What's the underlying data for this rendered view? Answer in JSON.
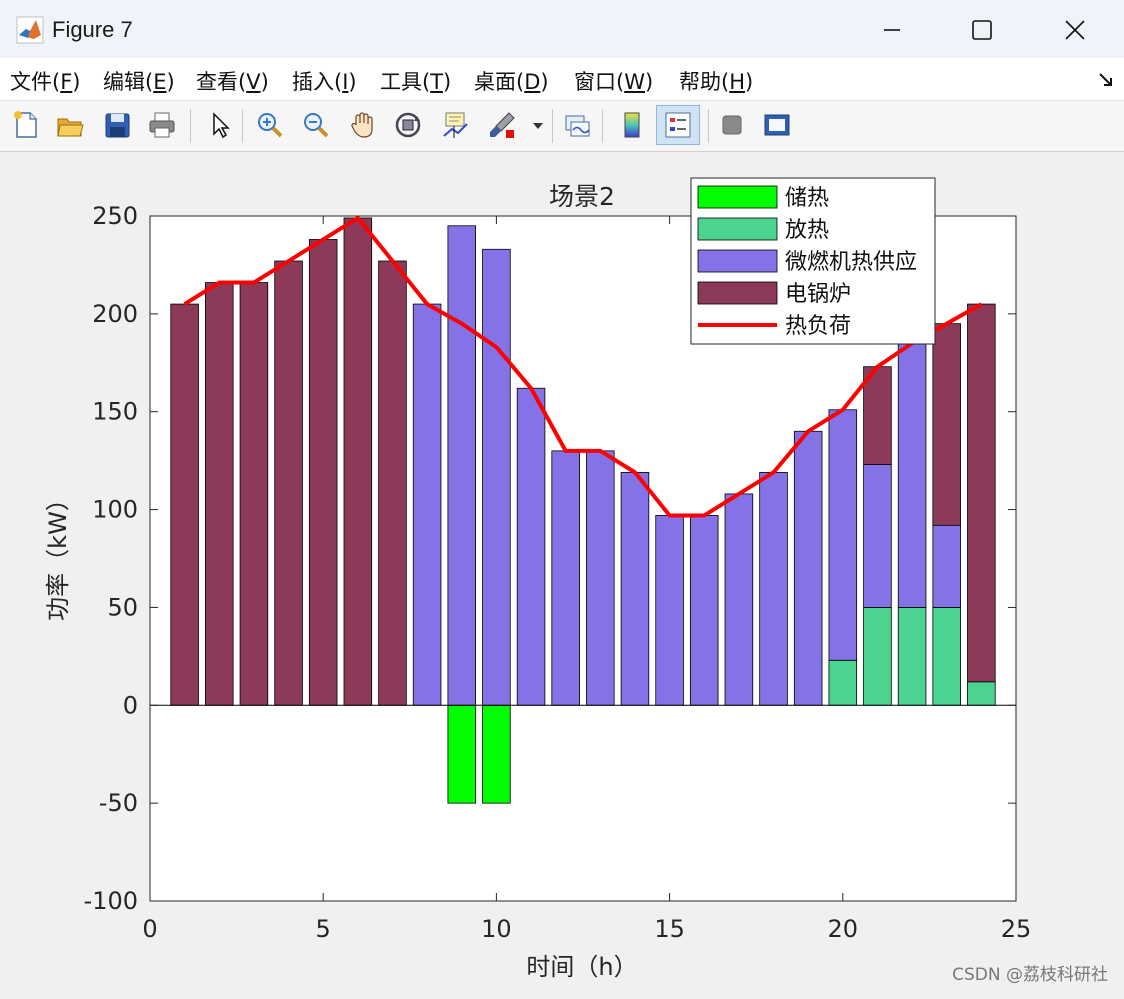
{
  "window": {
    "title": "Figure 7"
  },
  "menu": [
    {
      "text": "文件(",
      "key": "F",
      "end": ")"
    },
    {
      "text": "编辑(",
      "key": "E",
      "end": ")"
    },
    {
      "text": "查看(",
      "key": "V",
      "end": ")"
    },
    {
      "text": "插入(",
      "key": "I",
      "end": ")"
    },
    {
      "text": "工具(",
      "key": "T",
      "end": ")"
    },
    {
      "text": "桌面(",
      "key": "D",
      "end": ")"
    },
    {
      "text": "窗口(",
      "key": "W",
      "end": ")"
    },
    {
      "text": "帮助(",
      "key": "H",
      "end": ")"
    }
  ],
  "toolbar": {
    "tools": [
      "new-figure-icon",
      "open-file-icon",
      "save-icon",
      "print-icon",
      "pointer-icon",
      "zoom-in-icon",
      "zoom-out-icon",
      "pan-hand-icon",
      "rotate-3d-icon",
      "data-cursor-icon",
      "brush-icon",
      "link-plot-icon",
      "colorbar-icon",
      "legend-icon",
      "hide-plot-tools-icon",
      "show-plot-tools-icon"
    ],
    "active": "legend-icon"
  },
  "watermark": "CSDN @荔枝科研社",
  "chart_data": {
    "type": "bar",
    "title": "场景2",
    "xlabel": "时间（h）",
    "ylabel": "功率（kW）",
    "xlim": [
      0,
      25
    ],
    "ylim": [
      -100,
      250
    ],
    "xticks": [
      0,
      5,
      10,
      15,
      20,
      25
    ],
    "yticks": [
      -100,
      -50,
      0,
      50,
      100,
      150,
      200,
      250
    ],
    "grid": false,
    "stacked": true,
    "legend_position": "top-right",
    "x": [
      1,
      2,
      3,
      4,
      5,
      6,
      7,
      8,
      9,
      10,
      11,
      12,
      13,
      14,
      15,
      16,
      17,
      18,
      19,
      20,
      21,
      22,
      23,
      24
    ],
    "series": [
      {
        "name": "储热",
        "kind": "bar",
        "color": "#00ff00",
        "values": [
          0,
          0,
          0,
          0,
          0,
          0,
          0,
          0,
          -50,
          -50,
          0,
          0,
          0,
          0,
          0,
          0,
          0,
          0,
          0,
          0,
          0,
          0,
          0,
          0
        ]
      },
      {
        "name": "放热",
        "kind": "bar",
        "color": "#4dd390",
        "values": [
          0,
          0,
          0,
          0,
          0,
          0,
          0,
          0,
          0,
          0,
          0,
          0,
          0,
          0,
          0,
          0,
          0,
          0,
          0,
          23,
          50,
          50,
          50,
          12
        ]
      },
      {
        "name": "微燃机热供应",
        "kind": "bar",
        "color": "#8473e6",
        "values": [
          0,
          0,
          0,
          0,
          0,
          0,
          0,
          205,
          245,
          233,
          162,
          130,
          130,
          119,
          97,
          97,
          108,
          119,
          140,
          128,
          73,
          143,
          42,
          0
        ]
      },
      {
        "name": "电锅炉",
        "kind": "bar",
        "color": "#8d3a5a",
        "values": [
          205,
          216,
          216,
          227,
          238,
          249,
          227,
          0,
          0,
          0,
          0,
          0,
          0,
          0,
          0,
          0,
          0,
          0,
          0,
          0,
          50,
          0,
          103,
          193
        ]
      },
      {
        "name": "热负荷",
        "kind": "line",
        "color": "#ff0000",
        "values": [
          205,
          216,
          216,
          227,
          238,
          249,
          227,
          205,
          195,
          183,
          162,
          130,
          130,
          119,
          97,
          97,
          108,
          119,
          140,
          151,
          173,
          185,
          195,
          205
        ]
      }
    ]
  }
}
